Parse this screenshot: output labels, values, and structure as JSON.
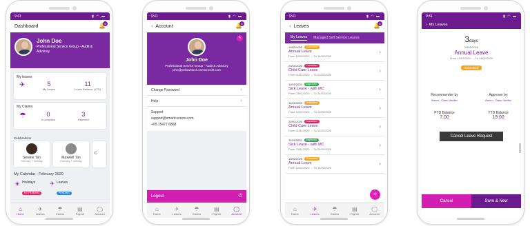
{
  "status_time": "9:41",
  "status_icons": "▮ ◠ ▬",
  "tabs": [
    "Home",
    "Leaves",
    "Claims",
    "Payroll",
    "Account"
  ],
  "notif_count": "5",
  "dashboard": {
    "title": "Dashboard",
    "name": "John Doe",
    "group": "Professional Service Group - Audit & Advisory",
    "my_leaves": {
      "label": "My leaves",
      "stat1_value": "5",
      "stat1_label": "My leaves",
      "stat2_value": "11",
      "stat2_label": "Leave Balance (YTD)"
    },
    "my_claims": {
      "label": "My Claims",
      "stat1_value": "0",
      "stat1_label": "In progress",
      "stat2_value": "3",
      "stat2_label": "Rejected"
    },
    "celebrations_label": "Celebrations",
    "celebrations": [
      {
        "name": "Serene Tan",
        "date": "February 7, birthday"
      },
      {
        "name": "Maxwell Tan",
        "date": "February 7, birthday"
      },
      {
        "name": "C",
        "date": ""
      }
    ],
    "calendar_title": "My Calendar - February 2020",
    "legend": [
      {
        "label": "Holidays",
        "tag": "NO PENDING"
      },
      {
        "label": "Leaves",
        "tag": "PENDING"
      }
    ]
  },
  "account": {
    "title": "Account",
    "name": "John Doe",
    "group": "Professional Service Group - Audit & Advisory",
    "email": "john@yellowblock.onmicrosoft.com",
    "menu": [
      "Change Password",
      "Help"
    ],
    "support_label": "Support",
    "support_email": "support@smartcursors.com",
    "support_phone": "+65 15477 6868",
    "logout": "Logout"
  },
  "leaves": {
    "title": "Leaves",
    "tabs": [
      "My Leaves",
      "Managed Self Service Leaves"
    ],
    "items": [
      {
        "date": "10/02/2020",
        "status": "Submitted",
        "title": "Annual Leave",
        "from": "12/02/2020",
        "to": "14/02/2020"
      },
      {
        "date": "20/01/2020",
        "status": "Cancelled",
        "title": "Child Care Leave",
        "from": "01/01/2020",
        "to": "02/01/2020"
      },
      {
        "date": "11/01/2020",
        "status": "Approved",
        "title": "Sick Leave - with MC",
        "from": "23/01/2020",
        "to": "24/01/2020"
      },
      {
        "date": "10/02/2020",
        "status": "Submitted",
        "title": "Annual Leave",
        "from": "12/02/2020",
        "to": "14/02/2020"
      },
      {
        "date": "20/01/2020",
        "status": "Cancelled",
        "title": "Child Care Leave",
        "from": "01/01/2020",
        "to": "02/01/2020"
      },
      {
        "date": "11/01/2020",
        "status": "Approved",
        "title": "Sick Leave - with MC",
        "from": "23/01/2020",
        "to": "24/01/2020"
      },
      {
        "date": "10/02/2020",
        "status": "Submitted",
        "title": "Annual Leave",
        "from": "12/02/2020",
        "to": "14/02/2020"
      }
    ],
    "from_label": "From",
    "to_label": "To"
  },
  "detail": {
    "title": "My Leaves",
    "days_num": "3",
    "days_unit": "days",
    "date": "10/02/2020",
    "type": "Annual Leave",
    "from": "12/02/2020",
    "to": "14/02/2020",
    "status": "Submitted",
    "recommender_label": "Recommender by",
    "recommender": "Aaron - Claim Verifier",
    "approver_label": "Approver by",
    "approver": "Aaron - Claim Verifier",
    "ptd_label": "PTD Balance",
    "ptd": "7.00",
    "ytd_label": "YTD Balance",
    "ytd": "19.00",
    "cancel_request": "Cancel Leave Request",
    "cancel": "Cancel",
    "save_new": "Save & New"
  },
  "colors": {
    "purple": "#6c1b8f",
    "magenta": "#e01fb8",
    "submitted": "#f5a623",
    "cancelled": "#e0245e",
    "approved": "#3aa757"
  }
}
